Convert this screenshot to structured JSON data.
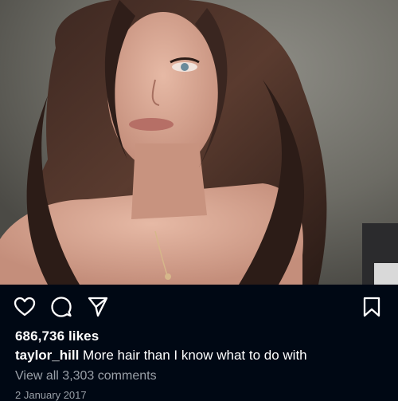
{
  "post": {
    "likes_label": "686,736 likes",
    "username": "taylor_hill",
    "caption": "More hair than I know what to do with",
    "view_comments_label": "View all 3,303 comments",
    "date": "2 January 2017"
  },
  "actions": {
    "like_icon": "heart-icon",
    "comment_icon": "speech-bubble-icon",
    "share_icon": "paper-plane-icon",
    "save_icon": "bookmark-icon"
  },
  "colors": {
    "background": "#000814",
    "text": "#ffffff",
    "secondary_text": "#9aa0a8"
  }
}
